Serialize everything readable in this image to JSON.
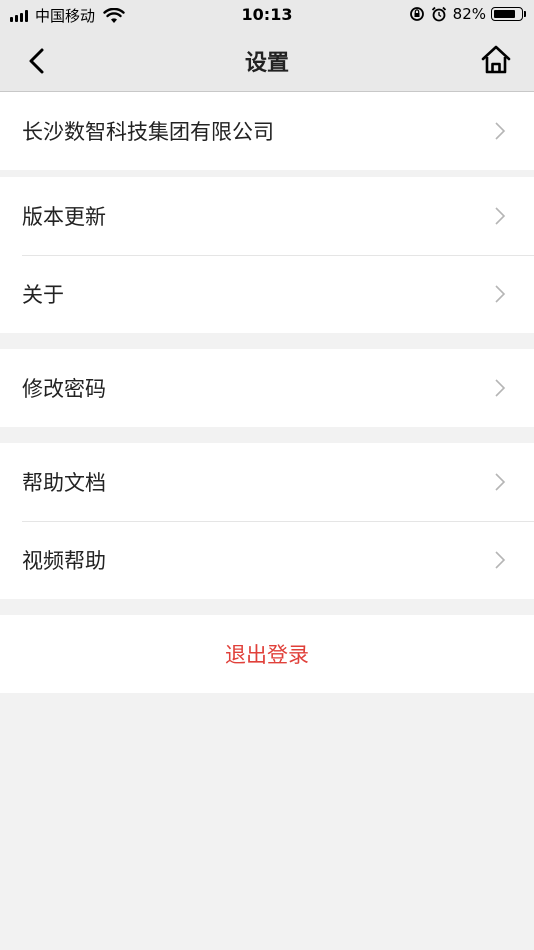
{
  "status_bar": {
    "carrier": "中国移动",
    "time": "10:13",
    "battery": "82%",
    "battery_level": 0.82
  },
  "nav": {
    "title": "设置"
  },
  "groups": [
    {
      "items": [
        {
          "label": "长沙数智科技集团有限公司"
        }
      ]
    },
    {
      "items": [
        {
          "label": "版本更新"
        },
        {
          "label": "关于"
        }
      ]
    },
    {
      "items": [
        {
          "label": "修改密码"
        }
      ]
    },
    {
      "items": [
        {
          "label": "帮助文档"
        },
        {
          "label": "视频帮助"
        }
      ]
    }
  ],
  "logout": {
    "label": "退出登录",
    "color": "#e0403a"
  }
}
